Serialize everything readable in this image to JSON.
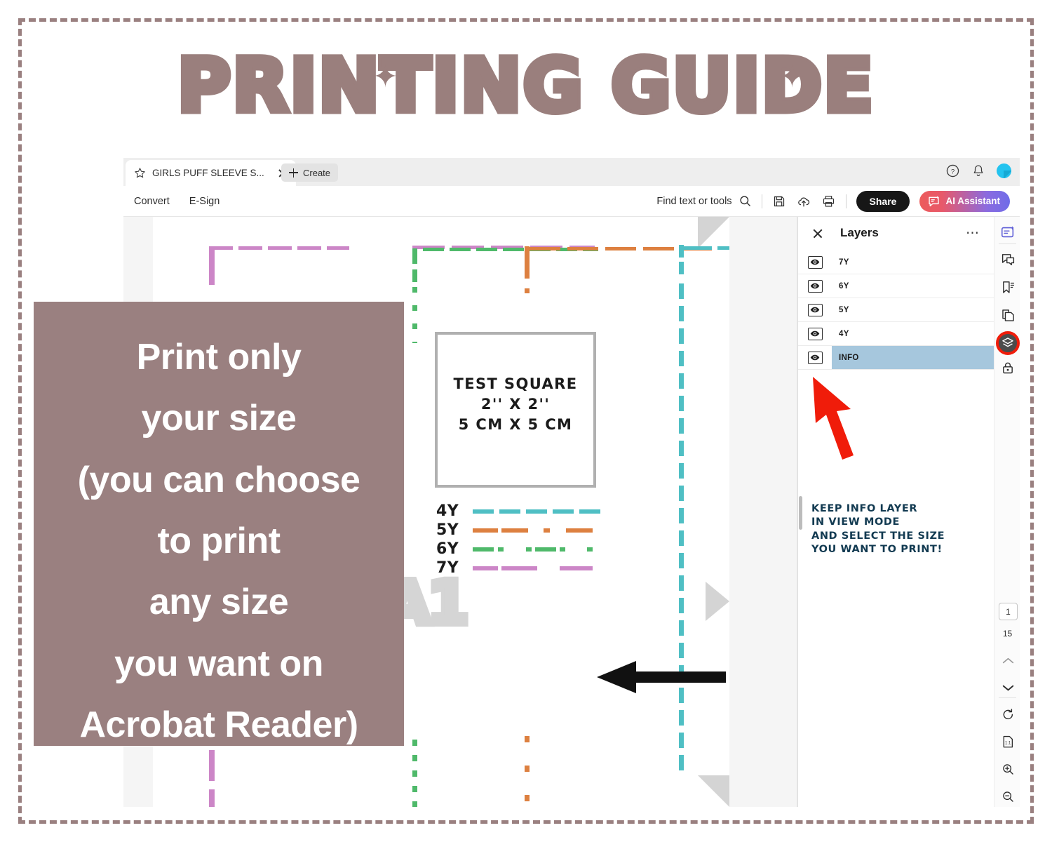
{
  "poster": {
    "title": "PRINTING GUIDE",
    "frame_color": "#9a8080",
    "title_color": "#9a7f7d"
  },
  "overlay": {
    "background": "#9a8080",
    "text": "Print only\nyour size\n(you can choose\nto print\nany size\nyou want on\nAcrobat Reader)"
  },
  "acrobat": {
    "tab": {
      "title": "GIRLS PUFF SLEEVE S...",
      "star_icon": "star-icon",
      "close_icon": "close-icon"
    },
    "create_tab": {
      "label": "Create",
      "icon": "plus-icon"
    },
    "header_icons": [
      {
        "name": "help-icon",
        "glyph": "?"
      },
      {
        "name": "notifications-bell-icon",
        "glyph": "bell"
      },
      {
        "name": "avatar",
        "glyph": "avatar"
      }
    ],
    "toolbar": {
      "convert_label": "Convert",
      "esign_label": "E-Sign",
      "find_label": "Find text or tools",
      "find_icon": "search-icon",
      "save_icon": "save-icon",
      "upload_icon": "cloud-upload-icon",
      "print_icon": "print-icon",
      "share_label": "Share",
      "ai_assistant_label": "AI Assistant",
      "ai_assistant_icon": "ai-sparkle-chat-icon",
      "ai_gradient_from": "#ec5b5b",
      "ai_gradient_to": "#6f6ce8"
    },
    "layers_panel": {
      "title": "Layers",
      "close_icon": "close-icon",
      "more_icon": "more-options-icon",
      "selected_color": "#a6c7dd",
      "rows": [
        {
          "name": "7Y",
          "visible": true,
          "selected": false
        },
        {
          "name": "6Y",
          "visible": true,
          "selected": false
        },
        {
          "name": "5Y",
          "visible": true,
          "selected": false
        },
        {
          "name": "4Y",
          "visible": true,
          "selected": false
        },
        {
          "name": "INFO",
          "visible": true,
          "selected": true
        }
      ]
    },
    "annotation": {
      "text": "KEEP INFO LAYER\nIN VIEW MODE\nAND SELECT THE SIZE\nYOU WANT TO PRINT!",
      "color": "#123a51",
      "arrow_color": "#f01c0a"
    },
    "rail_icons": [
      {
        "name": "ai-edit-icon",
        "active": false
      },
      {
        "name": "comment-icon",
        "active": false
      },
      {
        "name": "bookmark-icon",
        "active": false
      },
      {
        "name": "page-thumbnails-icon",
        "active": false
      },
      {
        "name": "layers-icon",
        "active": true
      },
      {
        "name": "lock-icon",
        "active": false
      }
    ],
    "page_nav": {
      "current_page": "1",
      "total_pages": "15",
      "prev_icon": "chevron-up-icon",
      "next_icon": "chevron-down-icon",
      "rotate_icon": "rotate-icon",
      "fit_page_icon": "fit-page-icon",
      "zoom_in_icon": "zoom-in-icon",
      "zoom_out_icon": "zoom-out-icon"
    }
  },
  "pdf_page": {
    "watermark": "A1",
    "test_square": {
      "line1": "TEST SQUARE",
      "line2": "2'' X 2''",
      "line3": "5 CM X 5 CM",
      "border_color": "#b0b0b0"
    },
    "size_legend": [
      {
        "label": "4Y",
        "color": "#4fbfc4",
        "style": "dashed"
      },
      {
        "label": "5Y",
        "color": "#dd8040",
        "style": "dash-dot"
      },
      {
        "label": "6Y",
        "color": "#4fb96a",
        "style": "dash-dot-dot"
      },
      {
        "label": "7Y",
        "color": "#cc86c7",
        "style": "long-dash"
      }
    ],
    "arrow_icon": "left-arrow-icon"
  }
}
